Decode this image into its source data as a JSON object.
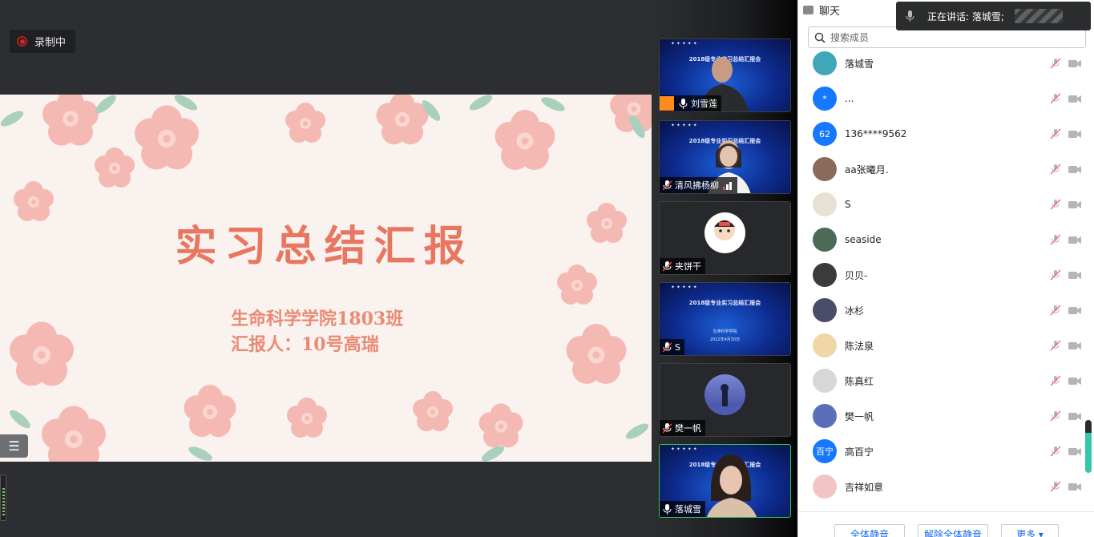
{
  "recording": {
    "label": "录制中"
  },
  "slide": {
    "title": "实习总结汇报",
    "subtitle_line1": "生命科学学院1803班",
    "subtitle_line2": "汇报人：10号高瑞"
  },
  "video_tiles": [
    {
      "name": "刘雪莲",
      "banner": "2018级专业实习总结汇报会"
    },
    {
      "name": "清风拂杨柳",
      "banner": "2018级专业实习总结汇报会"
    },
    {
      "name": "夹饼干"
    },
    {
      "name": "S",
      "banner": "2018级专业实习总结汇报会",
      "dept": "生命科学学院",
      "date": "2022年4月30日"
    },
    {
      "name": "樊一帆"
    },
    {
      "name": "落城雪",
      "banner": "2018级专业实习总结汇报会"
    }
  ],
  "panel": {
    "tab_label": "聊天",
    "search_placeholder": "搜索成员",
    "speaking_label": "正在讲话: 落城雪;"
  },
  "members": [
    {
      "name": "落城雪",
      "avatar_text": "",
      "avatar_color": "#3fa7b8"
    },
    {
      "name": "...",
      "avatar_text": "*",
      "avatar_color": "#1677ff"
    },
    {
      "name": "136****9562",
      "avatar_text": "62",
      "avatar_color": "#1677ff"
    },
    {
      "name": "aa张曦月.",
      "avatar_text": "",
      "avatar_color": "#8a6a5a"
    },
    {
      "name": "S",
      "avatar_text": "",
      "avatar_color": "#e8e0d2"
    },
    {
      "name": "seaside",
      "avatar_text": "",
      "avatar_color": "#4c6a55"
    },
    {
      "name": "贝贝-",
      "avatar_text": "",
      "avatar_color": "#3b3b3b"
    },
    {
      "name": "冰杉",
      "avatar_text": "",
      "avatar_color": "#4a4d6a"
    },
    {
      "name": "陈法泉",
      "avatar_text": "",
      "avatar_color": "#f0d7a8"
    },
    {
      "name": "陈真红",
      "avatar_text": "",
      "avatar_color": "#d7d7d7"
    },
    {
      "name": "樊一帆",
      "avatar_text": "",
      "avatar_color": "#5a6fb8"
    },
    {
      "name": "高百宁",
      "avatar_text": "百宁",
      "avatar_color": "#1677ff"
    },
    {
      "name": "吉祥如意",
      "avatar_text": "",
      "avatar_color": "#f3c4c4"
    }
  ],
  "footer": {
    "mute_all": "全体静音",
    "unmute_all": "解除全体静音",
    "more": "更多 ▾"
  },
  "colors": {
    "accent_green": "#35c65a",
    "link_blue": "#1d6de6",
    "slide_title": "#e87761"
  }
}
